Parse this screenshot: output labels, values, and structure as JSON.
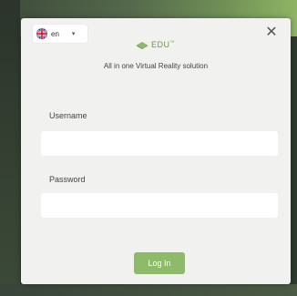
{
  "language": {
    "code": "en",
    "flag_icon": "uk-flag-icon",
    "chevron_icon": "chevron-down-icon"
  },
  "close_icon": "close-icon",
  "logo": {
    "text": "EDU",
    "superscript": "™",
    "color": "#6a9a3f"
  },
  "tagline": "All in one Virtual Reality solution",
  "form": {
    "username_label": "Username",
    "username_value": "",
    "password_label": "Password",
    "password_value": "",
    "login_label": "Log In"
  },
  "colors": {
    "accent": "#8dbb6a",
    "dialog_bg": "#f1f1ef"
  }
}
